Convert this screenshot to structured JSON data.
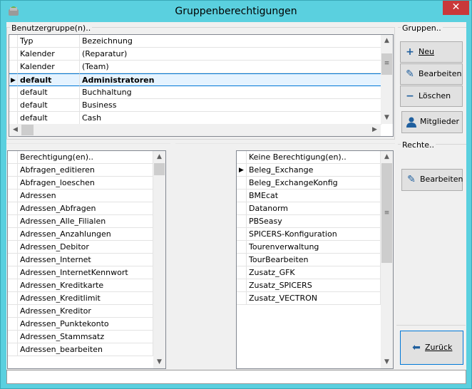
{
  "window": {
    "title": "Gruppenberechtigungen",
    "close_glyph": "✕"
  },
  "groups": {
    "label": "Benutzergruppe(n)..",
    "columns": [
      "Typ",
      "Bezeichnung"
    ],
    "rows": [
      {
        "typ": "Kalender",
        "bez": "(Reparatur)"
      },
      {
        "typ": "Kalender",
        "bez": "(Team)"
      },
      {
        "typ": "default",
        "bez": "Administratoren",
        "selected": true
      },
      {
        "typ": "default",
        "bez": "Buchhaltung"
      },
      {
        "typ": "default",
        "bez": "Business"
      },
      {
        "typ": "default",
        "bez": "Cash"
      }
    ]
  },
  "gruppen_box": {
    "label": "Gruppen..",
    "new": "Neu",
    "edit": "Bearbeiten",
    "delete": "Löschen",
    "members": "Mitglieder"
  },
  "rechte_box": {
    "label": "Rechte..",
    "edit": "Bearbeiten"
  },
  "back_button": {
    "label": "Zurück"
  },
  "permissions": {
    "header": "Berechtigung(en)..",
    "items": [
      "Abfragen_editieren",
      "Abfragen_loeschen",
      "Adressen",
      "Adressen_Abfragen",
      "Adressen_Alle_Filialen",
      "Adressen_Anzahlungen",
      "Adressen_Debitor",
      "Adressen_Internet",
      "Adressen_InternetKennwort",
      "Adressen_Kreditkarte",
      "Adressen_Kreditlimit",
      "Adressen_Kreditor",
      "Adressen_Punktekonto",
      "Adressen_Stammsatz",
      "Adressen_bearbeiten"
    ]
  },
  "no_permissions": {
    "header": "Keine Berechtigung(en)..",
    "items": [
      "Beleg_Exchange",
      "Beleg_ExchangeKonfig",
      "BMEcat",
      "Datanorm",
      "PBSeasy",
      "SPICERS-Konfiguration",
      "Tourenverwaltung",
      "TourBearbeiten",
      "Zusatz_GFK",
      "Zusatz_SPICERS",
      "Zusatz_VECTRON"
    ],
    "current_index": 0
  },
  "colors": {
    "titlebar": "#5ad0df",
    "close": "#c9383a",
    "selection_border": "#0078d7",
    "icon_blue": "#1f5f9e"
  },
  "icons": {
    "new": "plus-icon",
    "edit": "pencil-icon",
    "delete": "minus-icon",
    "members": "user-icon",
    "back": "back-arrow-icon",
    "row_pointer": "row-pointer-icon"
  }
}
